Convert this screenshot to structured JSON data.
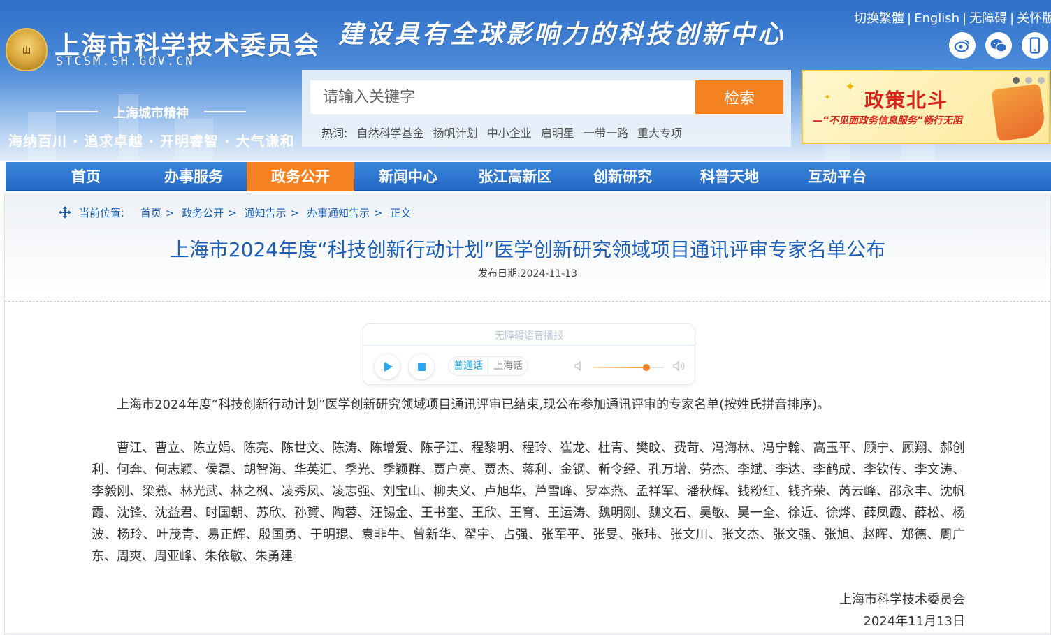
{
  "header": {
    "site_name": "上海市科学技术委员会",
    "site_domain": "STCSM.SH.GOV.CN",
    "emblem_text": "山",
    "slogan": "建设具有全球影响力的科技创新中心",
    "spirit_title": "上海城市精神",
    "spirit_text": "海纳百川 · 追求卓越 · 开明睿智 · 大气谦和",
    "util_links": [
      "切换繁體",
      "English",
      "无障碍",
      "关怀版"
    ],
    "social": [
      {
        "icon": "weibo-icon",
        "glyph": "◉"
      },
      {
        "icon": "wechat-icon",
        "glyph": "✉"
      },
      {
        "icon": "mobile-icon",
        "glyph": "▯"
      }
    ]
  },
  "search": {
    "placeholder": "请输入关键字",
    "button_label": "检索",
    "hotwords_label": "热词:",
    "hotwords": [
      "自然科学基金",
      "扬帆计划",
      "中小企业",
      "启明星",
      "一带一路",
      "重大专项"
    ]
  },
  "banner": {
    "title": "政策北斗",
    "subtitle": "—“不见面政务信息服务”畅行无阻"
  },
  "nav": {
    "items": [
      "首页",
      "办事服务",
      "政务公开",
      "新闻中心",
      "张江高新区",
      "创新研究",
      "科普天地",
      "互动平台"
    ],
    "active_index": 2
  },
  "breadcrumb": {
    "label": "当前位置:",
    "items": [
      "首页",
      "政务公开",
      "通知告示",
      "办事通知告示",
      "正文"
    ]
  },
  "article": {
    "title": "上海市2024年度“科技创新行动计划”医学创新研究领域项目通讯评审专家名单公布",
    "date": "发布日期:2024-11-13",
    "intro": "上海市2024年度“科技创新行动计划”医学创新研究领域项目通讯评审已结束,现公布参加通讯评审的专家名单(按姓氏拼音排序)。",
    "names": "曹江、曹立、陈立娟、陈亮、陈世文、陈涛、陈增爱、陈子江、程黎明、程玲、崔龙、杜青、樊旼、费苛、冯海林、冯宁翰、高玉平、顾宁、顾翔、郝创利、何奔、何志颖、侯磊、胡智海、华英汇、季光、季颖群、贾户亮、贾杰、蒋利、金钢、靳令经、孔万增、劳杰、李斌、李达、李鹤成、李钦传、李文涛、李毅刚、梁燕、林光武、林之枫、凌秀凤、凌志强、刘宝山、柳夫义、卢旭华、芦雪峰、罗本燕、孟祥军、潘秋辉、钱粉红、钱齐荣、芮云峰、邵永丰、沈帆霞、沈锋、沈益君、时国朝、苏欣、孙贇、陶蓉、汪锡金、王书奎、王欣、王育、王运涛、魏明刚、魏文石、吴敏、吴一全、徐近、徐烨、薛凤霞、薛松、杨波、杨玲、叶茂青、易正辉、殷国勇、于明琨、袁非牛、曾新华、翟宇、占强、张军平、张旻、张玮、张文川、张文杰、张文强、张旭、赵晖、郑德、周广东、周爽、周亚峰、朱依敏、朱勇建",
    "signature_org": "上海市科学技术委员会",
    "signature_date": "2024年11月13日"
  },
  "player": {
    "title": "无障碍语音播报",
    "lang_options": [
      "普通话",
      "上海话"
    ],
    "active_lang": 0,
    "volume": 0.75
  },
  "colors": {
    "primary_blue": "#2569c4",
    "active_orange": "#f58220",
    "title_blue": "#1d5fb8"
  }
}
